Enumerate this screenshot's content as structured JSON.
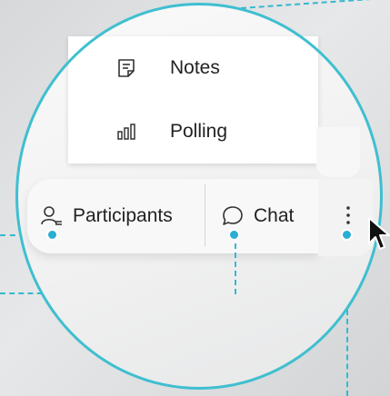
{
  "more_menu": {
    "items": [
      {
        "label": "Notes",
        "icon": "notes-icon"
      },
      {
        "label": "Polling",
        "icon": "polling-icon"
      }
    ]
  },
  "toolbar": {
    "participants_label": "Participants",
    "chat_label": "Chat",
    "more_icon": "more-vertical-icon"
  },
  "colors": {
    "callout_accent": "#3fbfd0",
    "callout_dot": "#2aaed4",
    "menu_background": "#ffffff",
    "toolbar_background": "#f8f8f8",
    "text": "#222222"
  }
}
